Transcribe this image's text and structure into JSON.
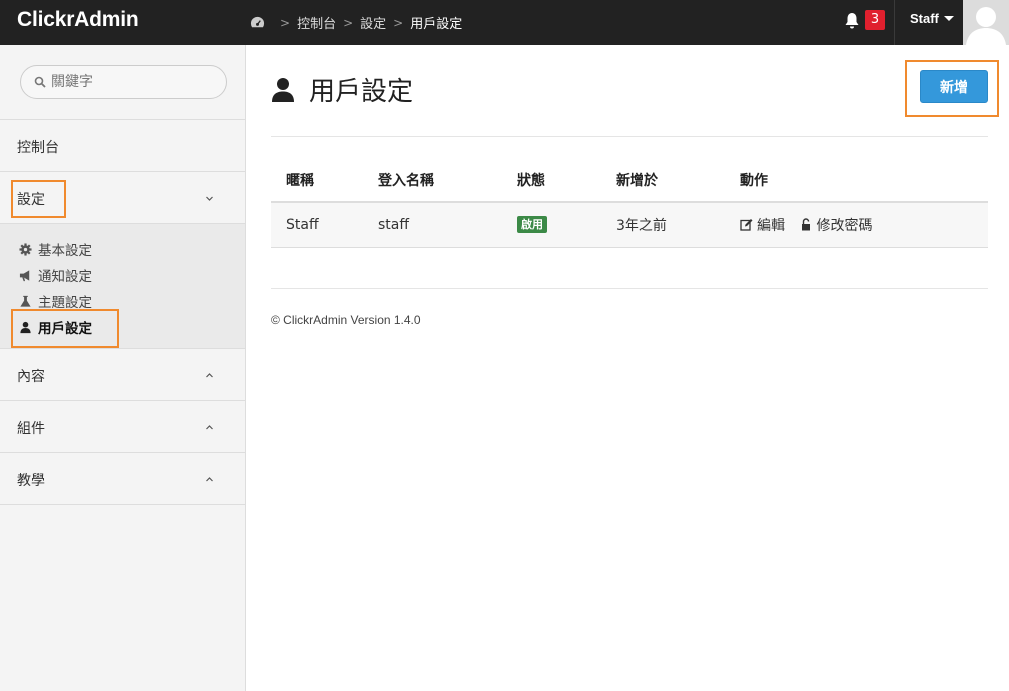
{
  "app": {
    "brand": "ClickrAdmin"
  },
  "breadcrumb": {
    "items": [
      "控制台",
      "設定",
      "用戶設定"
    ]
  },
  "topbar": {
    "notification_count": "3",
    "user_name": "Staff"
  },
  "sidebar": {
    "search_placeholder": "關鍵字",
    "items": [
      {
        "label": "控制台"
      },
      {
        "label": "設定"
      },
      {
        "label": "內容"
      },
      {
        "label": "組件"
      },
      {
        "label": "教學"
      }
    ],
    "submenu": [
      {
        "label": "基本設定",
        "icon": "gear-icon"
      },
      {
        "label": "通知設定",
        "icon": "megaphone-icon"
      },
      {
        "label": "主題設定",
        "icon": "flask-icon"
      },
      {
        "label": "用戶設定",
        "icon": "user-icon",
        "active": true
      }
    ]
  },
  "main": {
    "title": "用戶設定",
    "add_button": "新增",
    "table": {
      "headers": [
        "暱稱",
        "登入名稱",
        "狀態",
        "新增於",
        "動作"
      ],
      "rows": [
        {
          "nickname": "Staff",
          "login": "staff",
          "status": "啟用",
          "created": "3年之前",
          "edit": "編輯",
          "change_password": "修改密碼"
        }
      ]
    },
    "footer": "© ClickrAdmin Version 1.4.0"
  },
  "colors": {
    "topbar": "#222222",
    "accent": "#3498db",
    "status_active": "#3c8a47",
    "badge": "#e0202e",
    "highlight": "#f08a2e"
  }
}
